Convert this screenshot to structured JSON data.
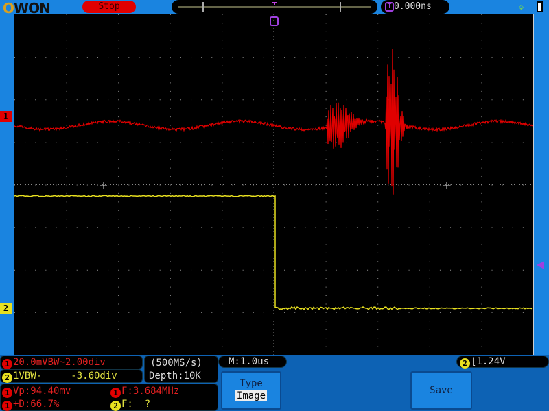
{
  "header": {
    "logo": "OWON",
    "run_state": "Stop",
    "trigger_position": "0.000ns"
  },
  "channels": {
    "ch1_marker": "1",
    "ch2_marker": "2"
  },
  "colors": {
    "ch1": "#e00000",
    "ch2": "#e8e020",
    "trigger": "#a040e0",
    "background": "#1a84e0"
  },
  "status": {
    "ch1_scale": "20.0mVBW~2.00div",
    "ch2_scale": "1VBW-     -3.60div",
    "sample_rate": "(500MS/s)",
    "depth": "Depth:10K",
    "timebase": "M:1.0us",
    "trigger_source": "2",
    "trigger_level": "1.24V"
  },
  "measurements": [
    {
      "ch": "1",
      "text": "Vp:94.40mv"
    },
    {
      "ch": "1",
      "text": "F:3.684MHz"
    },
    {
      "ch": "1",
      "text": "+D:66.7%"
    },
    {
      "ch": "2",
      "text": "F:  ?"
    }
  ],
  "menu": {
    "type_label": "Type",
    "type_value": "Image",
    "save_label": "Save"
  }
}
